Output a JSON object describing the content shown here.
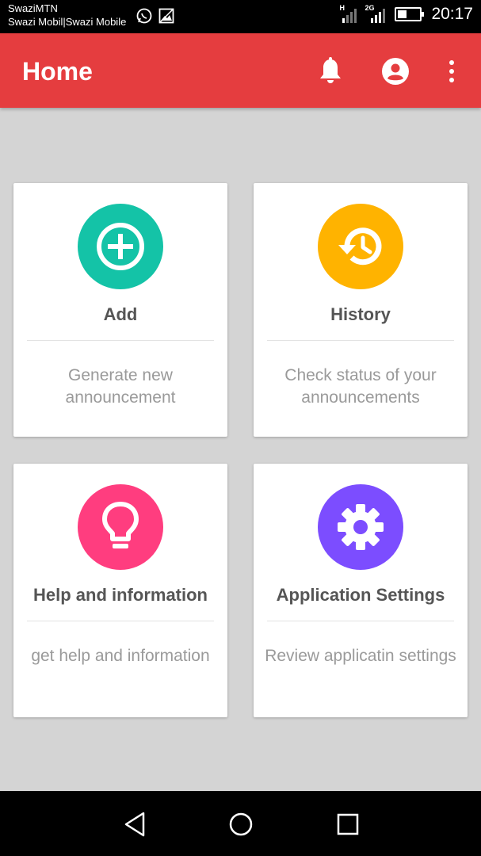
{
  "status_bar": {
    "carrier_line1": "SwaziMTN",
    "carrier_line2": "Swazi Mobil|Swazi Mobile",
    "network_1": "H",
    "network_2": "2G",
    "time": "20:17",
    "icons": [
      "whatsapp-icon",
      "image-icon",
      "signal-icon",
      "battery-icon"
    ]
  },
  "app_bar": {
    "title": "Home",
    "color": "#e53d3f",
    "icons": [
      "bell-icon",
      "account-icon",
      "more-vert-icon"
    ]
  },
  "cards": [
    {
      "title": "Add",
      "description": "Generate new announcement",
      "icon": "add-circle-icon",
      "color": "#14c3a7"
    },
    {
      "title": "History",
      "description": "Check status of your announcements",
      "icon": "history-icon",
      "color": "#ffb300"
    },
    {
      "title": "Help and information",
      "description": "get help and information",
      "icon": "lightbulb-icon",
      "color": "#ff3d7f"
    },
    {
      "title": "Application Settings",
      "description": "Review  applicatin settings",
      "icon": "settings-icon",
      "color": "#7c4dff"
    }
  ],
  "nav_bar": {
    "icons": [
      "back-icon",
      "home-icon",
      "recents-icon"
    ]
  }
}
